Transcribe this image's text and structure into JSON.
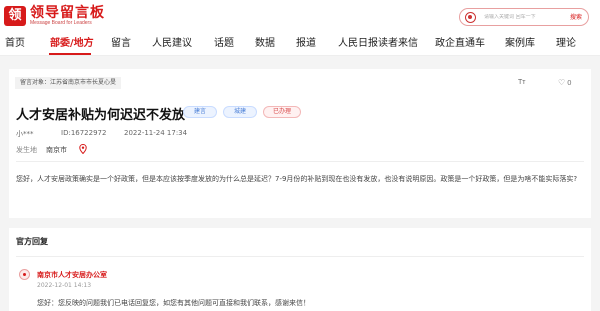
{
  "header": {
    "logo_char": "领",
    "logo_title": "领导留言板",
    "logo_subtitle": "Message Board for Leaders",
    "search_placeholder": "请输入关键词 回车一下",
    "search_button": "搜索"
  },
  "nav": {
    "items": [
      "首页",
      "部委/地方",
      "留言",
      "人民建议",
      "话题",
      "数据",
      "报道",
      "人民日报读者来信",
      "政企直通车",
      "案例库",
      "理论"
    ],
    "active_index": 1
  },
  "message": {
    "target": "留言对象：江苏省南京市市长夏心旻",
    "font_icon": "Tт",
    "like_count": "0",
    "title": "人才安居补贴为何迟迟不发放",
    "tags": [
      "建言",
      "城建",
      "已办理"
    ],
    "author": "小***",
    "id": "ID:16722972",
    "time": "2022-11-24 17:34",
    "location_label": "发生地",
    "location": "南京市",
    "body": "您好，人才安居政策确实是一个好政策，但是本应该按季度发放的为什么总是延迟？7-9月份的补贴到现在也没有发放，也没有说明原因。政策是一个好政策，但是为啥不能实际落实?"
  },
  "reply": {
    "section_title": "官方回复",
    "department": "南京市人才安居办公室",
    "time": "2022-12-01 14:13",
    "text": "您好：您反映的问题我们已电话回复您，如您有其他问题可直接和我们联系，感谢来信！"
  },
  "colors": {
    "brand": "#d71a1a",
    "tag_blue": "#4a7fd6",
    "tag_red": "#d84a4a"
  }
}
